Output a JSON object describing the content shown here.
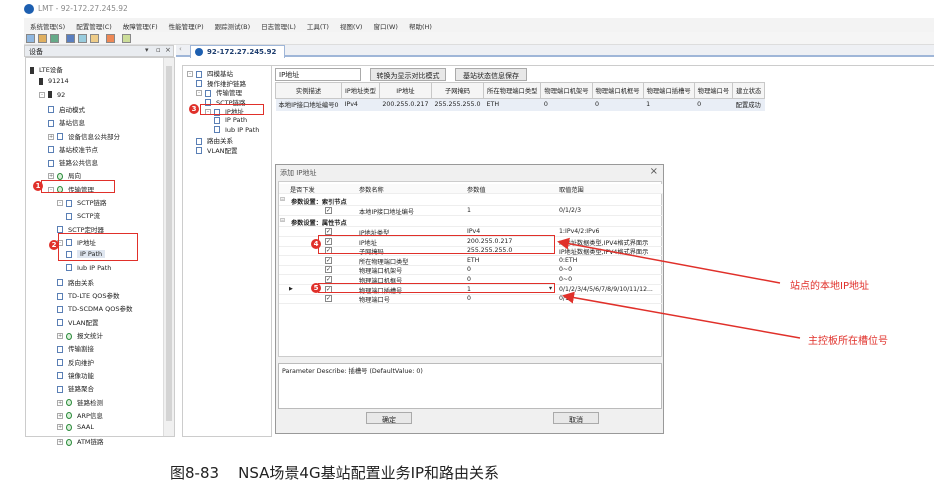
{
  "window": {
    "title": "LMT - 92-172.27.245.92"
  },
  "menu": [
    "系统管理(S)",
    "配置管理(C)",
    "故障管理(F)",
    "性能管理(P)",
    "跟踪测试(B)",
    "日志管理(L)",
    "工具(T)",
    "视图(V)",
    "窗口(W)",
    "帮助(H)"
  ],
  "device_panel": {
    "title": "设备",
    "controls": [
      "▾",
      "▫",
      "×"
    ]
  },
  "document_tab": {
    "label": "92-172.27.245.92"
  },
  "left_tree": [
    {
      "label": "LTE设备",
      "level": 0,
      "icon": "device"
    },
    {
      "label": "91214",
      "level": 1,
      "icon": "device"
    },
    {
      "label": "92",
      "level": 1,
      "icon": "device",
      "exp": "-"
    },
    {
      "label": "启动模式",
      "level": 2
    },
    {
      "label": "基站信息",
      "level": 2
    },
    {
      "label": "设备信息公共部分",
      "level": 2,
      "exp": "+"
    },
    {
      "label": "基站校准节点",
      "level": 2
    },
    {
      "label": "链路公共信息",
      "level": 2
    },
    {
      "label": "局向",
      "level": 2,
      "exp": "+",
      "icon": "group"
    },
    {
      "label": "传输管理",
      "level": 2,
      "exp": "-",
      "icon": "group"
    },
    {
      "label": "SCTP链路",
      "level": 3,
      "exp": "-"
    },
    {
      "label": "SCTP流",
      "level": 4
    },
    {
      "label": "SCTP定时器",
      "level": 3
    },
    {
      "label": "IP地址",
      "level": 3,
      "exp": "-"
    },
    {
      "label": "IP Path",
      "level": 4,
      "selected": true
    },
    {
      "label": "Iub IP Path",
      "level": 4
    },
    {
      "label": "路由关系",
      "level": 3
    },
    {
      "label": "TD-LTE QOS参数",
      "level": 3
    },
    {
      "label": "TD-SCDMA QOS参数",
      "level": 3
    },
    {
      "label": "VLAN配置",
      "level": 3
    },
    {
      "label": "报文统计",
      "level": 3,
      "exp": "+",
      "icon": "group"
    },
    {
      "label": "传输割接",
      "level": 3
    },
    {
      "label": "反向维护",
      "level": 3
    },
    {
      "label": "镜像功能",
      "level": 3
    },
    {
      "label": "链路聚合",
      "level": 3
    },
    {
      "label": "链路检测",
      "level": 3,
      "exp": "+",
      "icon": "group"
    },
    {
      "label": "ARP信息",
      "level": 3,
      "exp": "+",
      "icon": "group"
    },
    {
      "label": "SAAL",
      "level": 3,
      "exp": "+",
      "icon": "group"
    },
    {
      "label": "ATM链路",
      "level": 3,
      "exp": "+",
      "icon": "group"
    }
  ],
  "mid_tree": [
    {
      "label": "四模基站",
      "level": 0,
      "exp": "-"
    },
    {
      "label": "操作维护链路",
      "level": 1
    },
    {
      "label": "传输管理",
      "level": 1,
      "exp": "-"
    },
    {
      "label": "SCTP链路",
      "level": 2
    },
    {
      "label": "IP地址",
      "level": 2,
      "exp": "-"
    },
    {
      "label": "IP Path",
      "level": 3
    },
    {
      "label": "Iub IP Path",
      "level": 3
    },
    {
      "label": "路由关系",
      "level": 1
    },
    {
      "label": "VLAN配置",
      "level": 1
    }
  ],
  "main": {
    "filter_value": "IP地址",
    "compare_button": "转换为显示对比模式",
    "save_button": "基站状态信息保存",
    "columns": [
      "实例描述",
      "IP地址类型",
      "IP地址",
      "子网掩码",
      "所在物理端口类型",
      "物理端口机架号",
      "物理端口机框号",
      "物理端口插槽号",
      "物理端口号",
      "建立状态"
    ],
    "rows": [
      [
        "本地IP接口地址编号0",
        "IPv4",
        "200.255.0.217",
        "255.255.255.0",
        "ETH",
        "0",
        "0",
        "1",
        "0",
        "配置成功"
      ]
    ]
  },
  "dialog": {
    "title": "添加 IP地址",
    "close": "×",
    "columns": [
      "是否下发",
      "参数名称",
      "参数值",
      "取值范围"
    ],
    "groups": [
      {
        "label": "参数设置：索引节点",
        "rows": [
          {
            "name": "本地IP接口地址编号",
            "value": "1",
            "range": "0/1/2/3"
          }
        ]
      },
      {
        "label": "参数设置：属性节点",
        "rows": [
          {
            "name": "IP地址类型",
            "value": "IPv4",
            "range": "1:IPv4/2:IPv6"
          },
          {
            "name": "IP地址",
            "value": "200.255.0.217",
            "range": "IP地址数据类型,IPV4格式界面示"
          },
          {
            "name": "子网掩码",
            "value": "255.255.255.0",
            "range": "IP地址数据类型,IPV4格式界面示"
          },
          {
            "name": "所在物理端口类型",
            "value": "ETH",
            "range": "0:ETH"
          },
          {
            "name": "物理端口机架号",
            "value": "0",
            "range": "0~0"
          },
          {
            "name": "物理端口机框号",
            "value": "0",
            "range": "0~0"
          },
          {
            "name": "物理端口插槽号",
            "value": "1",
            "range": "0/1/2/3/4/5/6/7/8/9/10/11/12..."
          },
          {
            "name": "物理端口号",
            "value": "0",
            "range": "0/1"
          }
        ]
      }
    ],
    "description": "Parameter Describe: 插槽号 (DefaultValue: 0)",
    "ok_button": "确定",
    "cancel_button": "取消"
  },
  "annotations": {
    "markers": [
      "1",
      "2",
      "3",
      "4",
      "5"
    ],
    "local_ip_note": "站点的本地IP地址",
    "slot_note": "主控板所在槽位号",
    "color": "#e0302a"
  },
  "caption": "图8-83    NSA场景4G基站配置业务IP和路由关系"
}
